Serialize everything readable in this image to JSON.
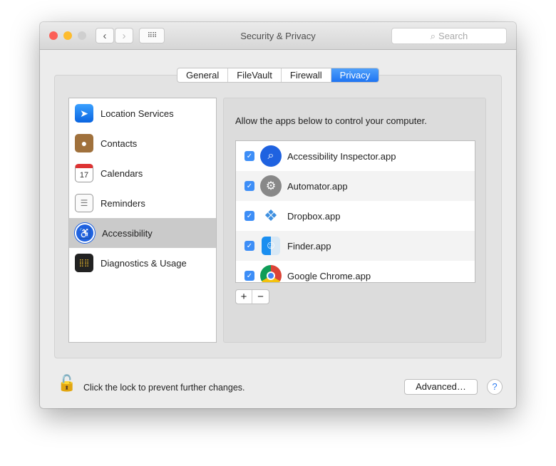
{
  "window": {
    "title": "Security & Privacy",
    "search_placeholder": "Search"
  },
  "tabs": [
    {
      "label": "General"
    },
    {
      "label": "FileVault"
    },
    {
      "label": "Firewall"
    },
    {
      "label": "Privacy",
      "active": true
    }
  ],
  "sidebar": {
    "items": [
      {
        "label": "Location Services",
        "icon": "location-arrow-icon"
      },
      {
        "label": "Contacts",
        "icon": "contacts-book-icon"
      },
      {
        "label": "Calendars",
        "icon": "calendar-icon",
        "icon_text": "17"
      },
      {
        "label": "Reminders",
        "icon": "reminders-list-icon"
      },
      {
        "label": "Accessibility",
        "icon": "accessibility-icon",
        "selected": true
      },
      {
        "label": "Diagnostics & Usage",
        "icon": "diagnostics-icon"
      }
    ]
  },
  "main": {
    "prompt": "Allow the apps below to control your computer.",
    "apps": [
      {
        "name": "Accessibility Inspector.app",
        "checked": true
      },
      {
        "name": "Automator.app",
        "checked": true
      },
      {
        "name": "Dropbox.app",
        "checked": true
      },
      {
        "name": "Finder.app",
        "checked": true
      },
      {
        "name": "Google Chrome.app",
        "checked": true
      }
    ],
    "add_label": "+",
    "remove_label": "−"
  },
  "footer": {
    "lock_text": "Click the lock to prevent further changes.",
    "advanced_label": "Advanced…",
    "help_label": "?"
  },
  "colors": {
    "accent": "#1e74f2",
    "selected_row": "#cacaca"
  }
}
